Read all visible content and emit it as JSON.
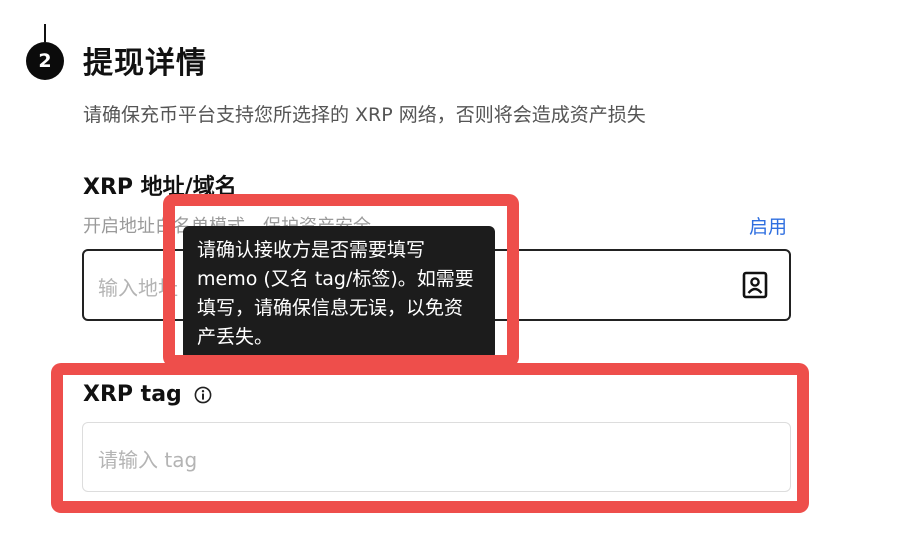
{
  "step": {
    "number": "2",
    "title": "提现详情",
    "description": "请确保充币平台支持您所选择的 XRP 网络，否则将会造成资产损失"
  },
  "address": {
    "label": "XRP 地址/域名",
    "whitelist_hint": "开启地址白名单模式，保护资产安全",
    "enable_label": "启用",
    "placeholder": "输入地址",
    "contacts_icon": "address-book-icon"
  },
  "tooltip": {
    "text": "请确认接收方是否需要填写memo (又名 tag/标签)。如需要填写，请确保信息无误，以免资产丢失。"
  },
  "tag": {
    "label": "XRP tag",
    "info_icon": "info-icon",
    "placeholder": "请输入 tag"
  },
  "colors": {
    "highlight": "#ee4e4b",
    "link": "#2f6fe0",
    "tooltip_bg": "#1c1c1c"
  }
}
